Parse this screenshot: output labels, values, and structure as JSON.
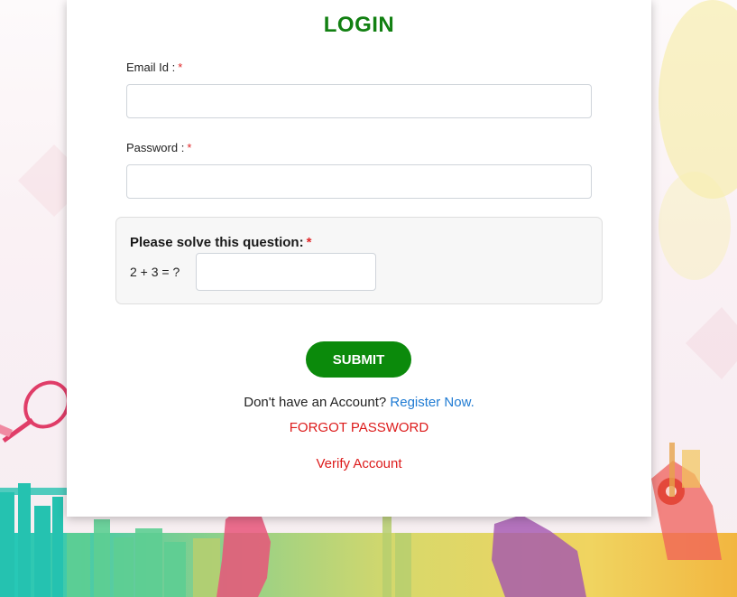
{
  "form": {
    "title": "LOGIN",
    "email_label": "Email Id :",
    "email_required": "*",
    "email_value": "",
    "password_label": "Password :",
    "password_required": "*",
    "password_value": "",
    "captcha_title": "Please solve this question:",
    "captcha_required": "*",
    "captcha_question": "2 + 3 = ?",
    "captcha_value": "",
    "submit_label": "SUBMIT",
    "no_account_text": "Don't have an Account?",
    "register_label": "Register Now.",
    "forgot_label": "FORGOT PASSWORD",
    "verify_label": "Verify Account"
  },
  "colors": {
    "title": "#128012",
    "submit_bg": "#0b8a0b",
    "link_blue": "#1f7bd3",
    "link_red": "#dd1c1c",
    "required": "#e0282a"
  }
}
